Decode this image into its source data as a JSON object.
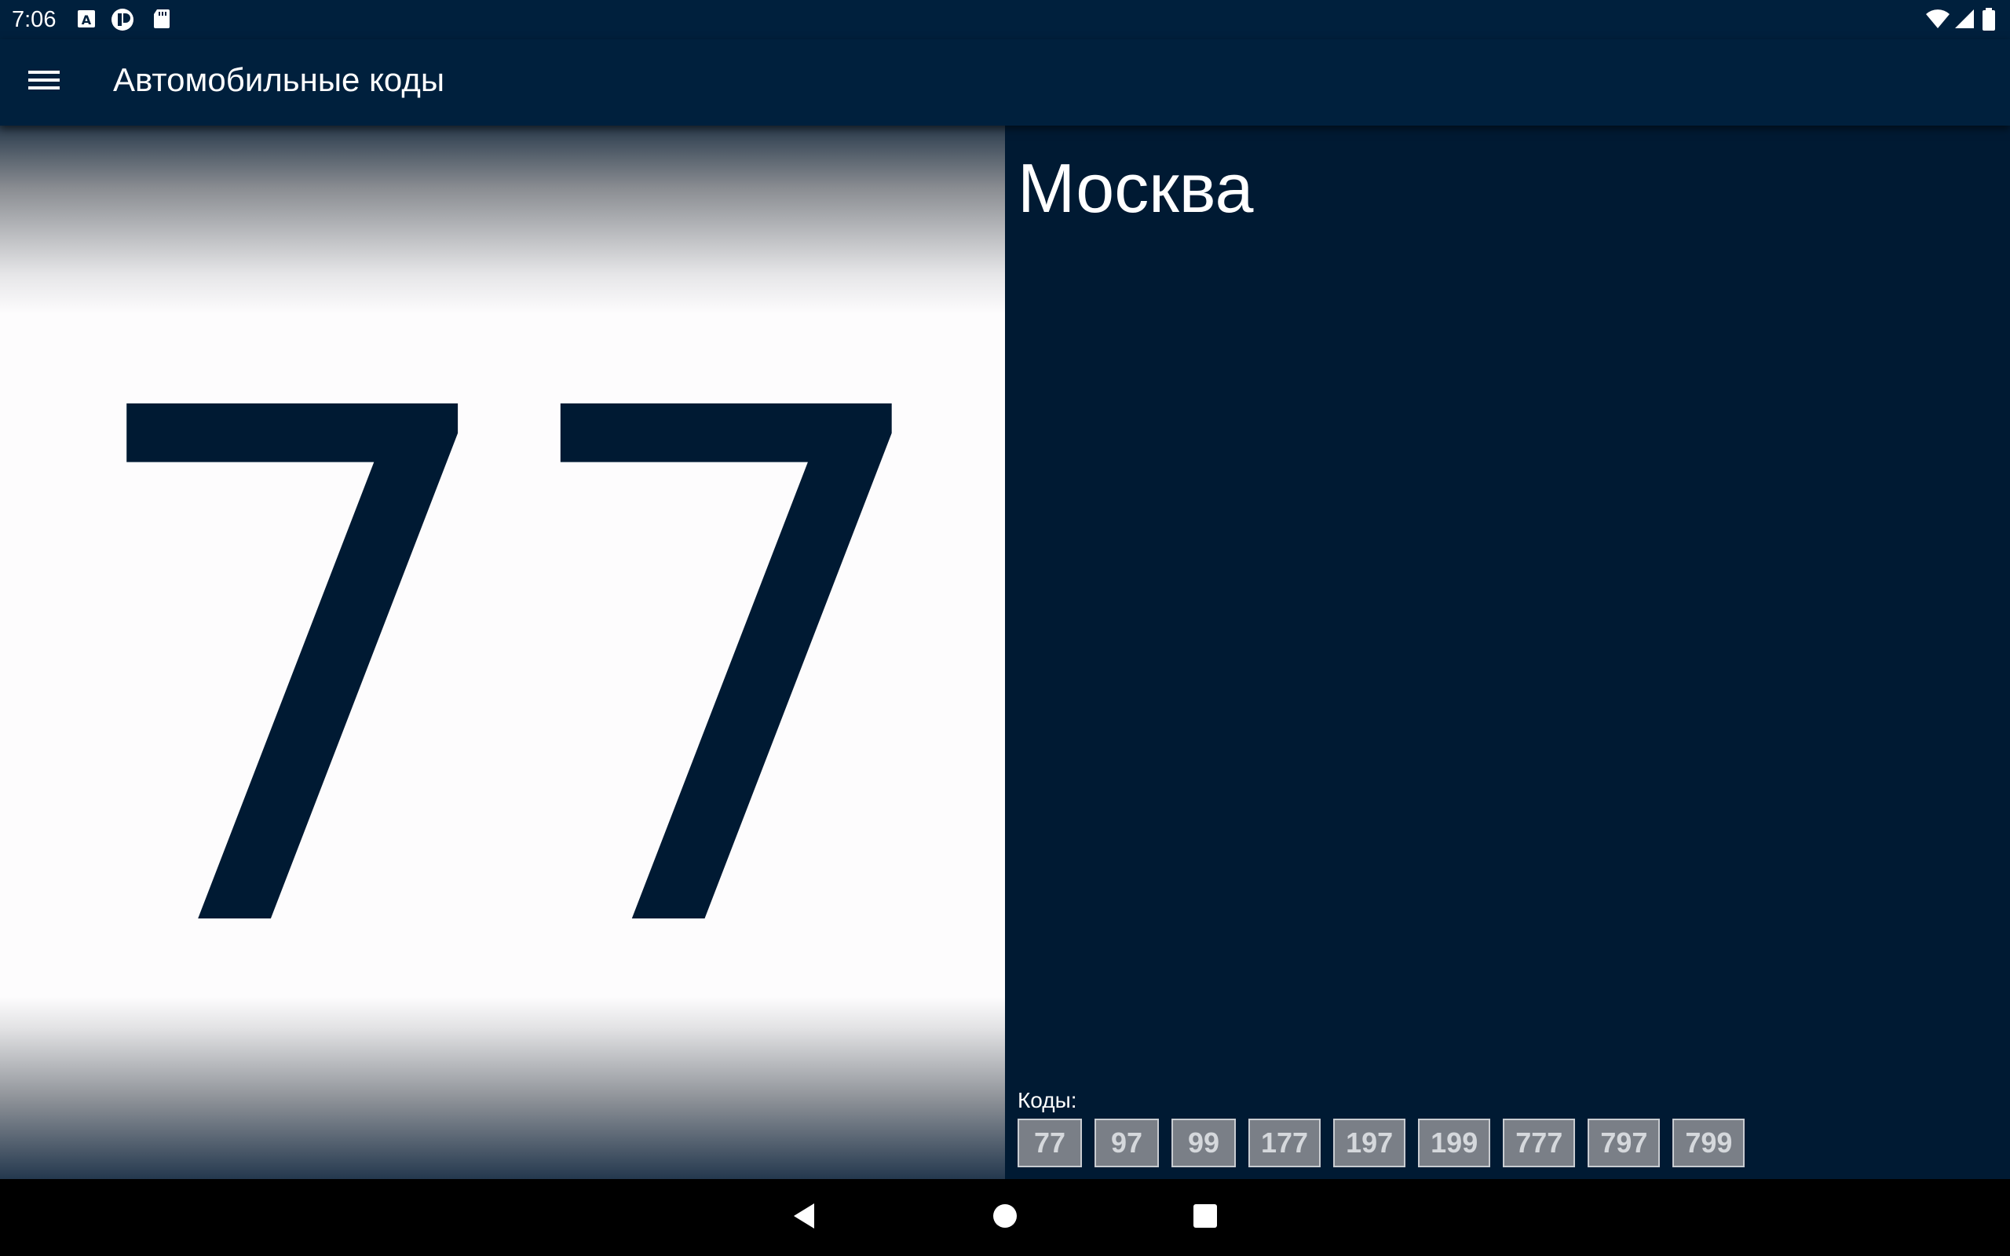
{
  "status_bar": {
    "time": "7:06",
    "left_icons": [
      "font-a-icon",
      "app-notification-icon",
      "sd-card-icon"
    ],
    "right_icons": [
      "wifi-icon",
      "cell-signal-icon",
      "battery-icon"
    ]
  },
  "app_bar": {
    "menu_icon": "hamburger-menu-icon",
    "title": "Автомобильные коды"
  },
  "plate": {
    "number": "77"
  },
  "region": {
    "name": "Москва",
    "codes_label": "Коды:",
    "codes": [
      "77",
      "97",
      "99",
      "177",
      "197",
      "199",
      "777",
      "797",
      "799"
    ]
  },
  "nav_bar": {
    "buttons": [
      "back-icon",
      "home-icon",
      "recents-icon"
    ]
  },
  "colors": {
    "primary_dark": "#001a33",
    "app_bar": "#00203d",
    "chip_bg": "#7a7f87",
    "chip_text": "#d5d8dc",
    "plate_bg": "#fdfcfd"
  }
}
